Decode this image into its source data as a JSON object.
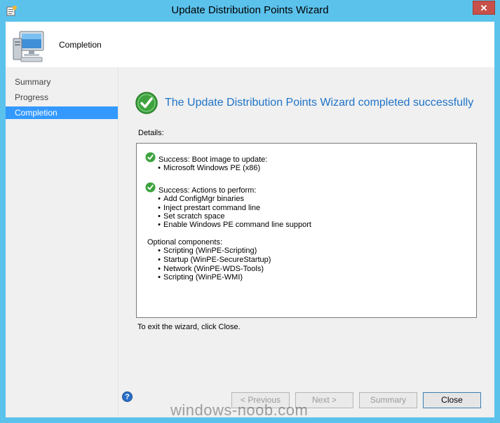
{
  "window": {
    "title": "Update Distribution Points Wizard",
    "close_glyph": "✕"
  },
  "header": {
    "title": "Completion",
    "icon": "computer-icon"
  },
  "sidebar": {
    "items": [
      {
        "label": "Summary"
      },
      {
        "label": "Progress"
      },
      {
        "label": "Completion",
        "active": true
      }
    ]
  },
  "main": {
    "banner": "The Update Distribution Points Wizard completed successfully",
    "details_label": "Details:",
    "details": {
      "success1": "Success: Boot image to update:",
      "success1_items": [
        "Microsoft Windows PE (x86)"
      ],
      "success2": "Success: Actions to perform:",
      "success2_items": [
        "Add ConfigMgr binaries",
        "Inject prestart command line",
        "Set scratch space",
        "Enable Windows PE command line support"
      ],
      "optional_heading": "Optional components:",
      "optional_items": [
        "Scripting (WinPE-Scripting)",
        "Startup (WinPE-SecureStartup)",
        "Network (WinPE-WDS-Tools)",
        "Scripting (WinPE-WMI)"
      ]
    },
    "exit_text": "To exit the wizard, click Close."
  },
  "buttons": {
    "previous": "< Previous",
    "next": "Next >",
    "summary": "Summary",
    "close": "Close",
    "help": "?"
  },
  "watermark": "windows-noob.com",
  "colors": {
    "accent": "#3399ff",
    "banner_text": "#1e73c8",
    "success": "#3ea33e",
    "titlebar": "#5bc2ec"
  }
}
